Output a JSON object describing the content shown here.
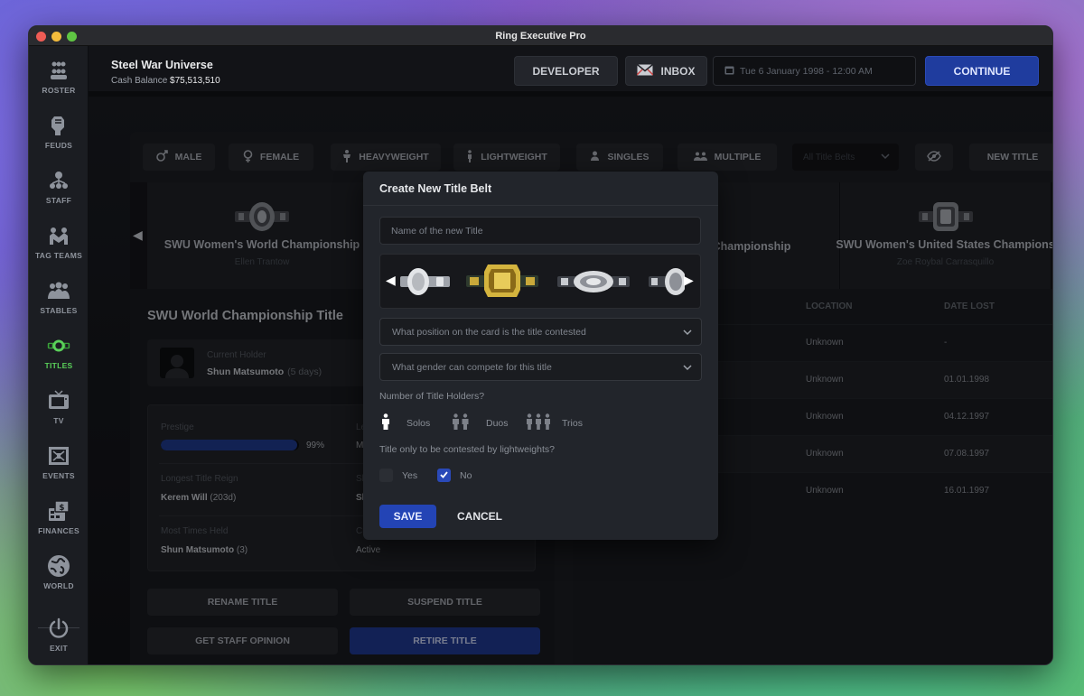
{
  "window": {
    "title": "Ring Executive Pro"
  },
  "sidebar": {
    "items": [
      {
        "label": "ROSTER",
        "icon": "roster-icon"
      },
      {
        "label": "FEUDS",
        "icon": "feuds-icon"
      },
      {
        "label": "STAFF",
        "icon": "staff-icon"
      },
      {
        "label": "TAG TEAMS",
        "icon": "tag-teams-icon"
      },
      {
        "label": "STABLES",
        "icon": "stables-icon"
      },
      {
        "label": "TITLES",
        "icon": "titles-icon",
        "active": true
      },
      {
        "label": "TV",
        "icon": "tv-icon"
      },
      {
        "label": "EVENTS",
        "icon": "events-icon"
      },
      {
        "label": "FINANCES",
        "icon": "finances-icon"
      },
      {
        "label": "WORLD",
        "icon": "world-icon"
      },
      {
        "label": "EXIT",
        "icon": "power-icon"
      }
    ],
    "active_color": "#5ad05a"
  },
  "header": {
    "universe": "Steel War Universe",
    "cash_label": "Cash Balance",
    "cash_value": "$75,513,510",
    "developer": "DEVELOPER",
    "inbox": "INBOX",
    "date": "Tue 6 January 1998 - 12:00 AM",
    "continue": "CONTINUE",
    "accent": "#1f3c9e"
  },
  "filters": {
    "male": "MALE",
    "female": "FEMALE",
    "heavyweight": "HEAVYWEIGHT",
    "lightweight": "LIGHTWEIGHT",
    "singles": "SINGLES",
    "multiple": "MULTIPLE",
    "select": "All Title Belts",
    "new_title": "NEW TITLE"
  },
  "carousel": {
    "cards": [
      {
        "name": "SWU Women's World Championship",
        "holder": "Ellen Trantow"
      },
      {
        "name": "Championship",
        "holder": ""
      },
      {
        "name": "SWU Women's United States Champions",
        "holder": "Zoe Roybal Carrasquillo"
      }
    ]
  },
  "detail": {
    "title": "SWU World Championship Title",
    "current_holder_label": "Current Holder",
    "current_holder": "Shun Matsumoto",
    "current_holder_days": "(5 days)",
    "prestige_label": "Prestige",
    "prestige_value": "99%",
    "prestige_fraction": 0.99,
    "level_label": "Level",
    "level_value": "Main Eve",
    "longest_label": "Longest Title Reign",
    "longest_name": "Kerem Will",
    "longest_days": "(203d)",
    "shortest_label": "Shortest",
    "shortest_value": "Shun Ma",
    "most_label": "Most Times Held",
    "most_name": "Shun Matsumoto",
    "most_count": "(3)",
    "current_label": "Current",
    "current_value": "Active",
    "rename": "RENAME TITLE",
    "suspend": "SUSPEND TITLE",
    "opinion": "GET STAFF OPINION",
    "retire": "RETIRE TITLE"
  },
  "history": {
    "col_location": "LOCATION",
    "col_date_lost": "DATE LOST",
    "rows": [
      {
        "location": "Unknown",
        "date_lost": "-"
      },
      {
        "location": "Unknown",
        "date_lost": "01.01.1998"
      },
      {
        "location": "Unknown",
        "date_lost": "04.12.1997"
      },
      {
        "location": "Unknown",
        "date_lost": "07.08.1997"
      },
      {
        "location": "Unknown",
        "date_lost": "16.01.1997"
      }
    ]
  },
  "modal": {
    "title": "Create New Title Belt",
    "name_placeholder": "Name of the new Title",
    "position_select": "What position on the card is the title contested",
    "gender_select": "What gender can compete for this title",
    "holders_label": "Number of Title Holders?",
    "solos": "Solos",
    "duos": "Duos",
    "trios": "Trios",
    "lightweight_label": "Title only to be contested by lightweights?",
    "yes": "Yes",
    "no": "No",
    "no_checked": true,
    "save": "SAVE",
    "cancel": "CANCEL"
  }
}
